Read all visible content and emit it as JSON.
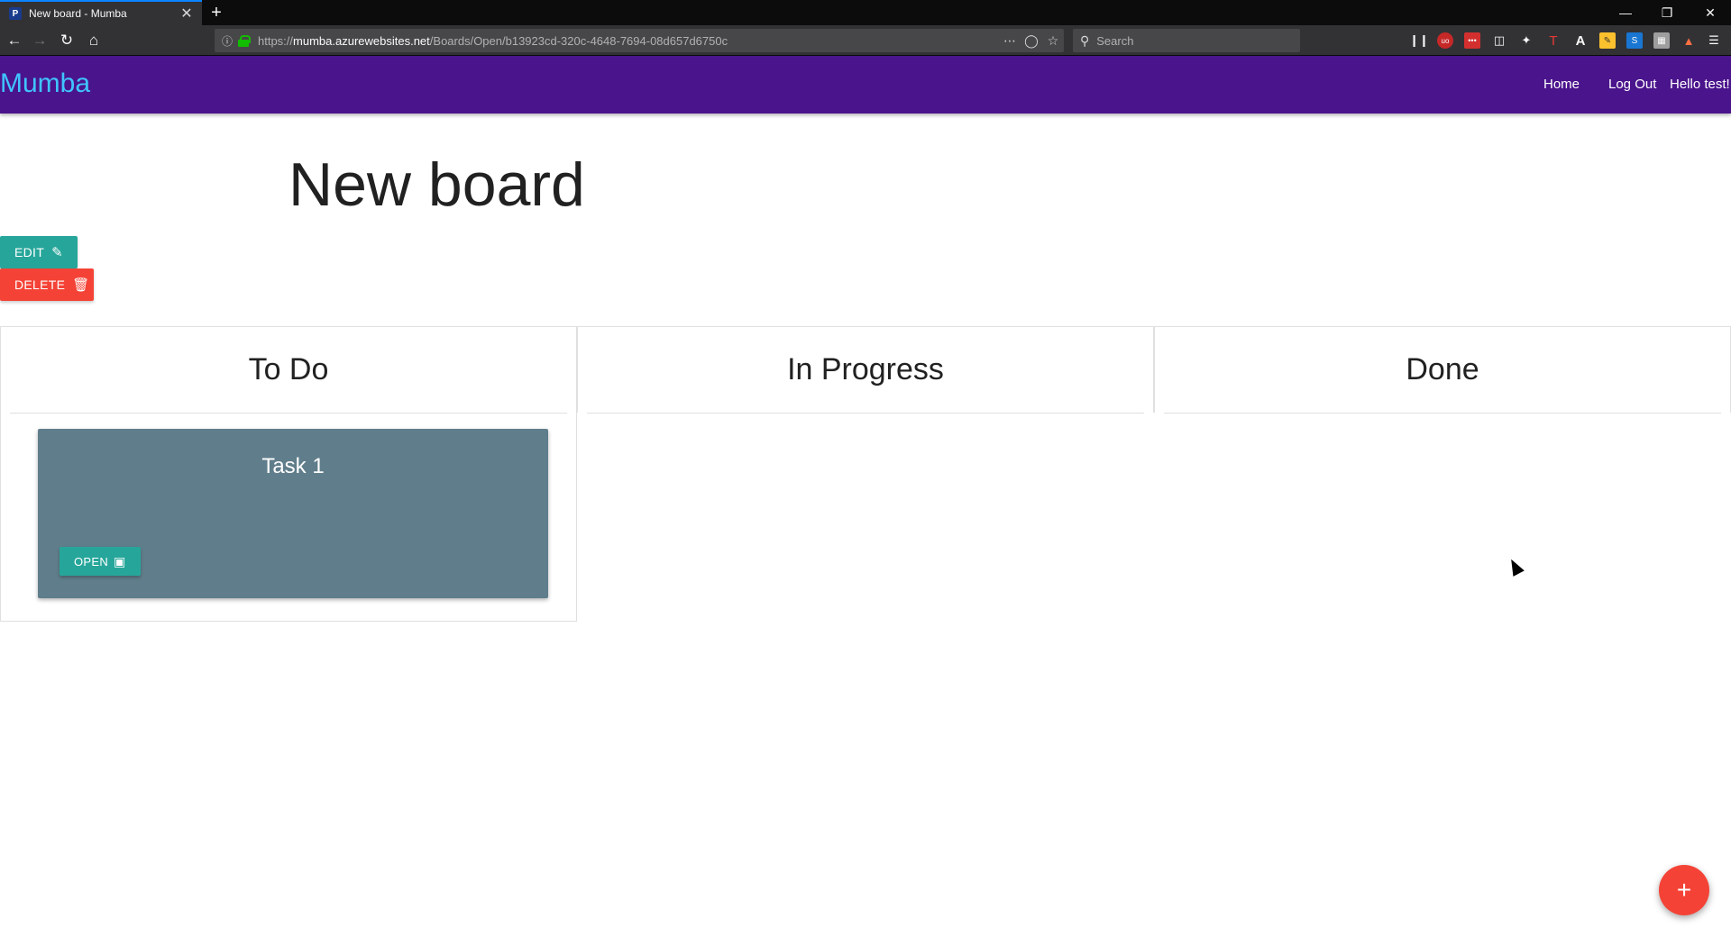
{
  "browser": {
    "tab_title": "New board - Mumba",
    "tab_favicon": "P",
    "tab_close": "✕",
    "new_tab": "+",
    "url_host_prefix": "https://",
    "url_host": "mumba.azurewebsites.net",
    "url_path": "/Boards/Open/b13923cd-320c-4648-7694-08d657d6750c",
    "search_placeholder": "Search",
    "win_minimize": "—",
    "win_restore": "❐",
    "win_close": "✕"
  },
  "app": {
    "brand": "Mumba",
    "nav": {
      "home": "Home",
      "logout": "Log Out",
      "greeting": "Hello test!"
    }
  },
  "board": {
    "title": "New board",
    "edit_label": "Edit",
    "delete_label": "Delete",
    "columns": [
      {
        "title": "To Do"
      },
      {
        "title": "In Progress"
      },
      {
        "title": "Done"
      }
    ],
    "tasks": [
      {
        "title": "Task 1",
        "open_label": "Open"
      }
    ],
    "fab_label": "+"
  },
  "colors": {
    "navbar": "#4a148c",
    "brand": "#40c4ff",
    "teal": "#26a69a",
    "red": "#f44336",
    "card": "#607d8b"
  }
}
